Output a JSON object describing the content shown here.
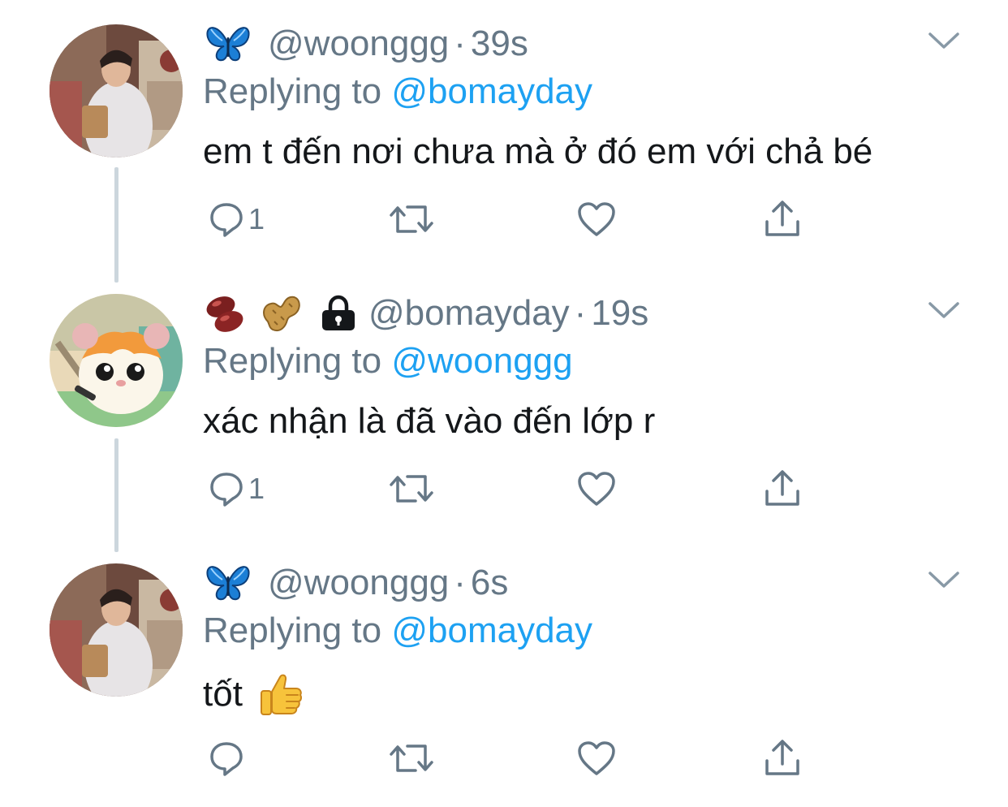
{
  "colors": {
    "link": "#1da1f2",
    "secondary_text": "#657786",
    "primary_text": "#14171a",
    "thread_line": "#ccd6dd"
  },
  "tweets": [
    {
      "name_emoji": [
        "butterfly-icon"
      ],
      "handle": "@woonggg",
      "separator": "·",
      "time": "39s",
      "replying_prefix": "Replying to ",
      "replying_to": "@bomayday",
      "text": "em t đến nơi chưa mà ở đó em với chả bé",
      "reply_count": "1",
      "avatar": "user-photo-avatar"
    },
    {
      "name_emoji": [
        "bean-icon",
        "peanut-icon"
      ],
      "protected_icon": "lock-icon",
      "handle": "@bomayday",
      "separator": "·",
      "time": "19s",
      "replying_prefix": "Replying to ",
      "replying_to": "@woonggg",
      "text": "xác nhận là đã vào đến lớp r",
      "reply_count": "1",
      "avatar": "hamster-cartoon-avatar"
    },
    {
      "name_emoji": [
        "butterfly-icon"
      ],
      "handle": "@woonggg",
      "separator": "·",
      "time": "6s",
      "replying_prefix": "Replying to ",
      "replying_to": "@bomayday",
      "text": "tốt",
      "text_emoji": "thumbs-up-icon",
      "reply_count": "",
      "avatar": "user-photo-avatar"
    }
  ]
}
